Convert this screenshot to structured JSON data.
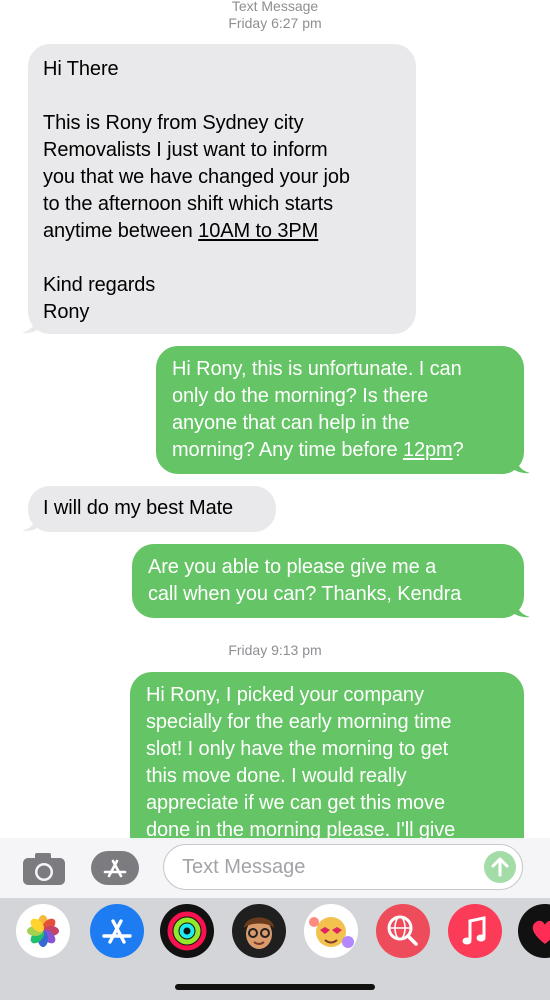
{
  "header": {
    "service": "Text Message",
    "timestamp1": "Friday 6:27 pm"
  },
  "messages": {
    "m1": {
      "line1": "Hi There",
      "line2": "This is Rony from Sydney city",
      "line3": "Removalists I just want to inform",
      "line4": "you that we have changed your job",
      "line5": "to the afternoon shift which starts",
      "line6_pre": "anytime between ",
      "line6_link": "10AM to 3PM",
      "line7": "Kind regards",
      "line8": "Rony"
    },
    "m2": {
      "line1": "Hi Rony, this is unfortunate. I can",
      "line2": "only do the morning? Is there",
      "line3": "anyone that can help in the",
      "line4_pre": "morning? Any time before ",
      "line4_link": "12pm",
      "line4_post": "?"
    },
    "m3": {
      "line1": "I will do my best Mate"
    },
    "m4": {
      "line1": "Are you able to please give me a",
      "line2": "call when you can? Thanks, Kendra"
    },
    "timestamp2": "Friday 9:13 pm",
    "m5": {
      "line1": "Hi Rony, I picked your company",
      "line2": "specially for the early morning time",
      "line3": "slot! I only have the morning to get",
      "line4": "this move done. I would really",
      "line5": "appreciate if we can get this move",
      "line6": "done in the morning please. I'll give"
    }
  },
  "input": {
    "placeholder": "Text Message"
  },
  "colors": {
    "incoming": "#e9e9eb",
    "outgoing": "#65c466",
    "send_disabled": "#a4dca7"
  },
  "icons": {
    "camera": "camera-icon",
    "apps": "app-store-icon",
    "send": "arrow-up-icon",
    "drawer": [
      "photos-icon",
      "app-store-icon",
      "activity-icon",
      "memoji-icon",
      "animoji-icon",
      "web-search-icon",
      "music-icon",
      "digital-touch-icon"
    ]
  }
}
